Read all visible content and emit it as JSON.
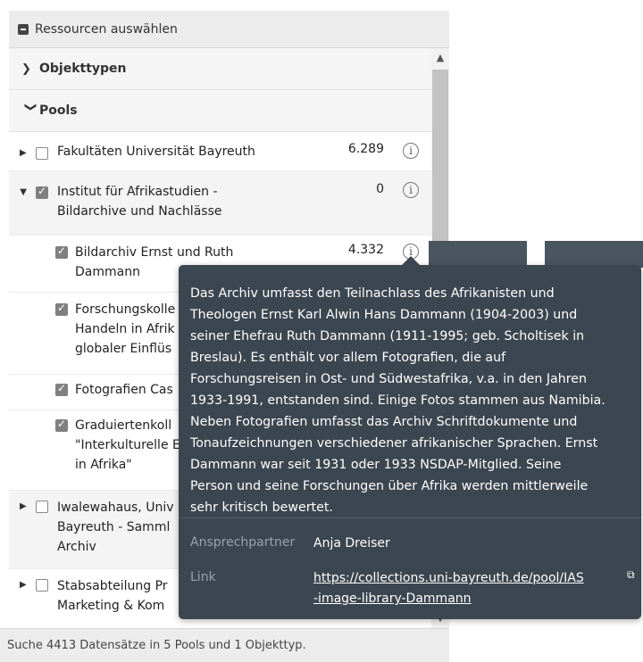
{
  "header": {
    "title": "Ressourcen auswählen"
  },
  "sections": {
    "objekttypen": "Objekttypen",
    "pools": "Pools"
  },
  "rows": [
    {
      "name_lines": [
        "Fakultäten Universität Bayreuth"
      ],
      "count": "6.289",
      "checked": false
    },
    {
      "name_lines": [
        "Institut für Afrikastudien -",
        "Bildarchive und Nachlässe"
      ],
      "count": "0",
      "checked": true
    },
    {
      "name_lines": [
        "Bildarchiv Ernst und Ruth",
        "Dammann"
      ],
      "count": "4.332",
      "checked": true
    },
    {
      "name_lines": [
        "Forschungskolle",
        "Handeln in Afrik",
        "globaler Einflüs"
      ],
      "checked": true
    },
    {
      "name_lines": [
        "Fotografien Cas"
      ],
      "checked": true
    },
    {
      "name_lines": [
        "Graduiertenkoll",
        "\"Interkulturelle E",
        "in Afrika\""
      ],
      "checked": true
    },
    {
      "name_lines": [
        "Iwalewahaus, Univ",
        "Bayreuth - Samml",
        "Archiv"
      ],
      "checked": false
    },
    {
      "name_lines": [
        "Stabsabteilung Pr",
        "Marketing & Kom"
      ],
      "checked": false
    }
  ],
  "tooltip": {
    "description_lines": [
      "Das Archiv umfasst den Teilnachlass des Afrikanisten und",
      "Theologen Ernst Karl Alwin Hans Dammann (1904-2003) und",
      "seiner Ehefrau Ruth Dammann (1911-1995; geb. Scholtisek in",
      "Breslau). Es enthält vor allem Fotografien, die auf",
      "Forschungsreisen in Ost- und Südwestafrika, v.a. in den Jahren",
      "1933-1991, entstanden sind. Einige Fotos stammen aus Namibia.",
      "Neben Fotografien umfasst das Archiv Schriftdokumente und",
      "Tonaufzeichnungen verschiedener afrikanischer Sprachen. Ernst",
      "Dammann war seit 1931 oder 1933 NSDAP-Mitglied. Seine",
      "Person und seine Forschungen über Afrika werden mittlerweile",
      "sehr kritisch bewertet."
    ],
    "contact_label": "Ansprechpartner",
    "contact_value": "Anja Dreiser",
    "link_label": "Link",
    "link_line1": "https://collections.uni-bayreuth.de/pool/IAS",
    "link_line2": "-image-library-Dammann"
  },
  "status": "Suche 4413 Datensätze in 5 Pools und 1 Objekttyp.",
  "colors": {
    "tooltip_bg": "#3b4650",
    "checked": "#808080"
  }
}
